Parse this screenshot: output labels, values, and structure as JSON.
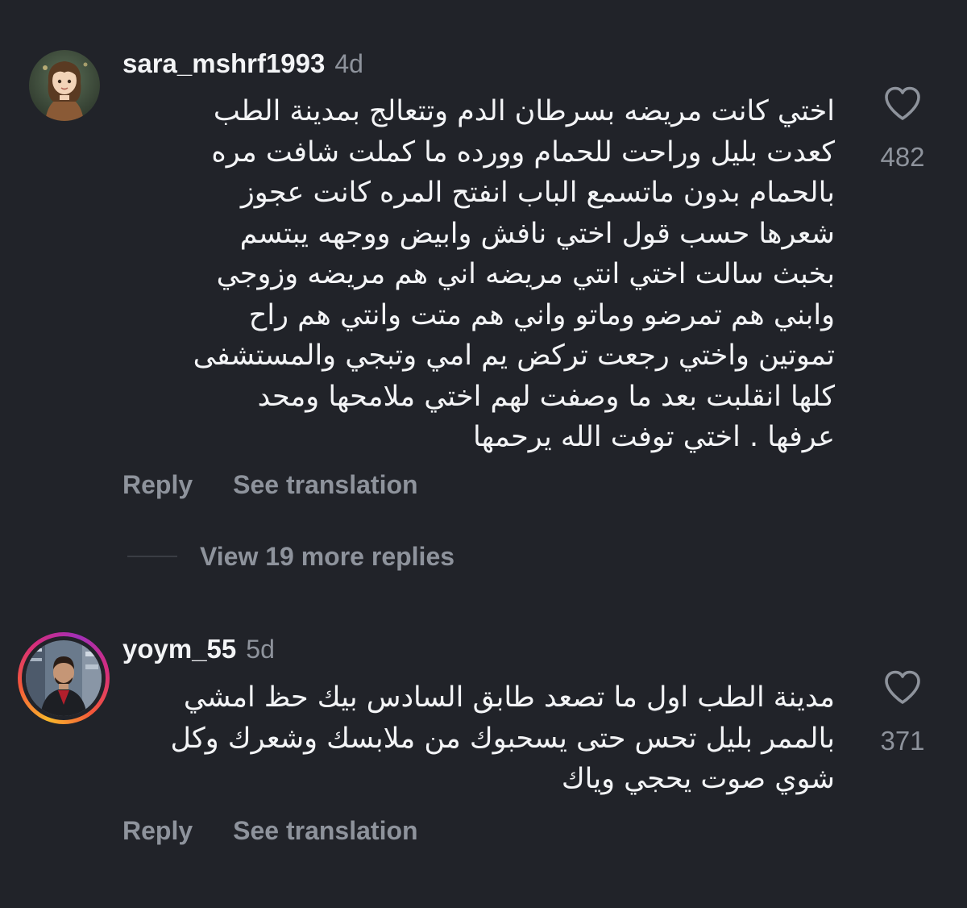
{
  "comments": [
    {
      "username": "sara_mshrf1993",
      "age": "4d",
      "lines": [
        "اختي كانت مريضه بسرطان الدم وتتعالج بمدينة الطب",
        "كعدت بليل وراحت للحمام وورده ما كملت شافت مره",
        "بالحمام بدون ماتسمع الباب انفتح المره كانت عجوز",
        "شعرها حسب قول اختي نافش وابيض ووجهه يبتسم",
        "بخبث سالت اختي  انتي مريضه اني هم مريضه وزوجي",
        "وابني هم تمرضو وماتو واني هم متت وانتي هم راح",
        "تموتين  واختي رجعت تركض يم امي وتبجي والمستشفى",
        "كلها انقلبت بعد ما وصفت لهم اختي ملامحها ومحد",
        "عرفها . اختي توفت الله يرحمها"
      ],
      "likes": "482",
      "reply_label": "Reply",
      "translate_label": "See translation",
      "more_replies_label": "View 19 more replies",
      "icon": "heart-outline-icon"
    },
    {
      "username": "yoym_55",
      "age": "5d",
      "lines": [
        "مدينة الطب اول ما تصعد طابق السادس بيك حظ امشي",
        "بالممر بليل تحس حتى يسحبوك من ملابسك وشعرك وكل",
        "شوي صوت يحجي وياك"
      ],
      "likes": "371",
      "reply_label": "Reply",
      "translate_label": "See translation",
      "icon": "heart-outline-icon",
      "has_story_ring": true
    }
  ],
  "colors": {
    "background": "#212329",
    "text_primary": "#f3f4f6",
    "text_secondary": "#8e939c"
  }
}
